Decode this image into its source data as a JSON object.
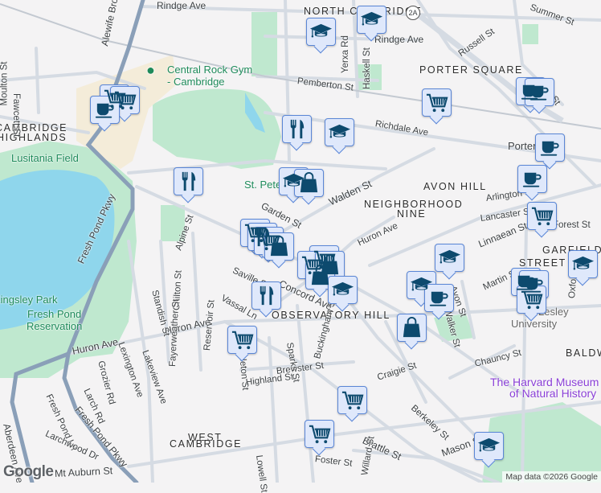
{
  "map": {
    "colors": {
      "water": "#8fd6ec",
      "park": "#bfe8cf",
      "road": "#d5dbe3",
      "highway": "#8a9fb8",
      "marker_bg": "#dfe8fb",
      "marker_border": "#5a86d6",
      "icon": "#0d4a6e"
    },
    "neighborhoods": [
      "NORTH CAMBRIDGE",
      "PORTER SQUARE",
      "AVON HILL",
      "NEIGHBORHOOD",
      "NINE",
      "OBSERVATORY HILL",
      "WEST",
      "CAMBRIDGE",
      "GARFIELD",
      "STREET",
      "BALDW",
      "CAMBRIDGE",
      "HIGHLANDS"
    ],
    "places": {
      "gym": "Central Rock Gym - Cambridge",
      "field": "Lusitania Field",
      "park1": "Kingsley Park",
      "park2": "Fresh Pond",
      "park3": "Reservation",
      "st_peter": "St. Peter",
      "museum1": "The Harvard Museum",
      "museum2": "of Natural History",
      "university": "Lesley",
      "university2": "University",
      "porter": "Porter"
    },
    "streets": [
      "Ridge Ave",
      "Rindge Ave",
      "Pemberton St",
      "Richdale Ave",
      "Russell St",
      "Elm St",
      "Summer St",
      "Yerxa Rd",
      "Haskell St",
      "Walden St",
      "Garden St",
      "Huron Ave",
      "Linnaean St",
      "Arlington St",
      "Lancaster St",
      "Forest St",
      "Concord Ave",
      "Saville St",
      "Vassal Ln",
      "Alpine St",
      "Standish St",
      "Chilton St",
      "Fayerweather St",
      "Reservoir St",
      "Appleton St",
      "Highland St",
      "Brewster St",
      "Sparks St",
      "Buckingham St",
      "Craigie St",
      "Berkeley St",
      "Brattle St",
      "Mason St",
      "Chauncy St",
      "Walker St",
      "Avon St",
      "Martin St",
      "Oxford St",
      "Lowell St",
      "Foster St",
      "Willard St",
      "Mt Auburn St",
      "Lexington Ave",
      "Lakeview Ave",
      "Grozier Rd",
      "Larch Rd",
      "Fresh Pond Ln",
      "Larchwood Dr",
      "Aberdeen Ave",
      "Fresh Pond Pkwy",
      "Alewife Brook Pkwy",
      "Moulton St",
      "Fawcett St",
      "2A"
    ],
    "attribution": "Map data ©2026 Google",
    "logo": "Google"
  }
}
